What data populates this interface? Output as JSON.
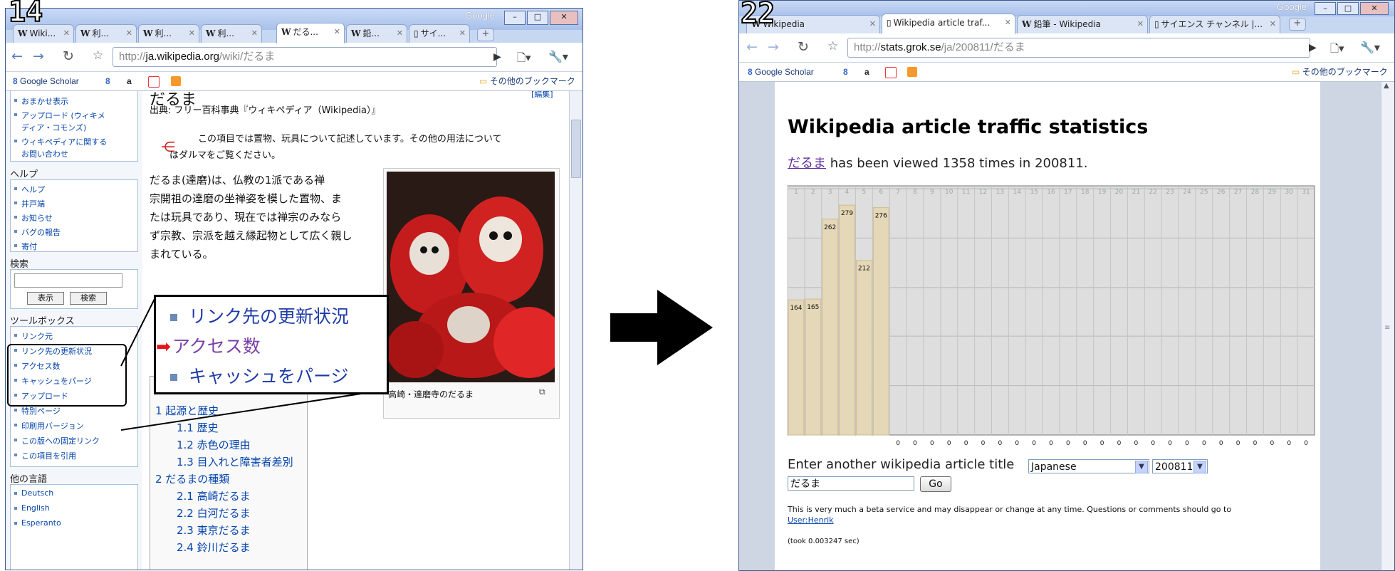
{
  "step_left": "14",
  "step_right": "22",
  "left": {
    "title_brand": "Google",
    "tabs": [
      {
        "label": "Wiki...",
        "active": false
      },
      {
        "label": "利...",
        "active": false
      },
      {
        "label": "利...",
        "active": false
      },
      {
        "label": "利...",
        "active": false
      },
      {
        "label": "だる...",
        "active": true
      },
      {
        "label": "鉛...",
        "active": false
      },
      {
        "label": "サイ...",
        "active": false
      }
    ],
    "url_scheme": "http://",
    "url_domain": "ja.wikipedia.org",
    "url_path": "/wiki/だるま",
    "bookmarks": {
      "scholar": "Google Scholar",
      "other": "その他のブックマーク"
    },
    "sidebar": {
      "top_items": [
        "おまかせ表示",
        "アップロード (ウィキメ",
        "ディア・コモンズ)",
        "ウィキペディアに関する",
        "お問い合わせ"
      ],
      "help_heading": "ヘルプ",
      "help_items": [
        "ヘルプ",
        "井戸端",
        "お知らせ",
        "バグの報告",
        "寄付"
      ],
      "search_heading": "検索",
      "search_buttons": [
        "表示",
        "検索"
      ],
      "toolbox_heading": "ツールボックス",
      "toolbox_items": [
        "リンク元",
        "リンク先の更新状況",
        "アクセス数",
        "キャッシュをパージ",
        "アップロード",
        "特別ページ",
        "印刷用バージョン",
        "この版への固定リンク",
        "この項目を引用"
      ],
      "lang_heading": "他の言語",
      "lang_items": [
        "Deutsch",
        "English",
        "Esperanto"
      ]
    },
    "article": {
      "title": "だるま",
      "edit": "[編集]",
      "source": "出典: フリー百科事典『ウィキペディア（Wikipedia）』",
      "hatnote1": "この項目では置物、玩具について記述しています。その他の用法について",
      "hatnote2": "はダルマをご覧ください。",
      "body": [
        "だるま(達磨)は、仏教の1派である禅",
        "宗開祖の達磨の坐禅姿を模した置物、ま",
        "たは玩具であり、現在では禅宗のみなら",
        "ず宗教、宗派を越え縁起物として広く親し",
        "まれている。"
      ],
      "caption": "高崎・達磨寺のだるま",
      "toc": [
        "1 起源と歴史",
        "1.1 歴史",
        "1.2 赤色の理由",
        "1.3 目入れと障害者差別",
        "2 だるまの種類",
        "2.1 高崎だるま",
        "2.2 白河だるま",
        "2.3 東京だるま",
        "2.4 鈴川だるま"
      ]
    },
    "callout": [
      "リンク先の更新状況",
      "アクセス数",
      "キャッシュをパージ"
    ]
  },
  "right": {
    "title_brand": "Google",
    "tabs": [
      {
        "label": "Wikipedia",
        "active": false
      },
      {
        "label": "Wikipedia article traf...",
        "active": true
      },
      {
        "label": "鉛筆 - Wikipedia",
        "active": false
      },
      {
        "label": "サイエンス チャンネル |...",
        "active": false
      }
    ],
    "url_scheme": "http://",
    "url_domain": "stats.grok.se",
    "url_path": "/ja/200811/だるま",
    "bookmarks": {
      "scholar": "Google Scholar",
      "other": "その他のブックマーク"
    },
    "heading": "Wikipedia article traffic statistics",
    "viewed_link": "だるま",
    "viewed_text": " has been viewed 1358 times in 200811.",
    "form_label": "Enter another wikipedia article title",
    "language_value": "Japanese",
    "month_value": "200811",
    "title_value": "だるま",
    "go_label": "Go",
    "note_text": "This is very much a beta service and may disappear or change at any time. Questions or comments should go to",
    "note_link": "User:Henrik",
    "took": "(took 0.003247 sec)"
  },
  "chart_data": {
    "type": "bar",
    "categories": [
      "1",
      "2",
      "3",
      "4",
      "5",
      "6",
      "7",
      "8",
      "9",
      "10",
      "11",
      "12",
      "13",
      "14",
      "15",
      "16",
      "17",
      "18",
      "19",
      "20",
      "21",
      "22",
      "23",
      "24",
      "25",
      "26",
      "27",
      "28",
      "29",
      "30",
      "31"
    ],
    "values": [
      164,
      165,
      262,
      279,
      212,
      276,
      0,
      0,
      0,
      0,
      0,
      0,
      0,
      0,
      0,
      0,
      0,
      0,
      0,
      0,
      0,
      0,
      0,
      0,
      0,
      0,
      0,
      0,
      0,
      0,
      0
    ],
    "value_labels": [
      "164",
      "165",
      "262",
      "279",
      "212",
      "276",
      "0",
      "0",
      "0",
      "0",
      "0",
      "0",
      "0",
      "0",
      "0",
      "0",
      "0",
      "0",
      "0",
      "0",
      "0",
      "0",
      "0",
      "0",
      "0",
      "0",
      "0",
      "0",
      "0",
      "0",
      "0"
    ],
    "yticks": [
      60,
      120,
      179,
      239,
      299
    ],
    "ylim": [
      0,
      299
    ],
    "grid": true
  },
  "colors": {
    "bar": "#e5d8b8",
    "arrow": "#000000",
    "link": "#0645ad",
    "pointer": "#e8141a"
  }
}
